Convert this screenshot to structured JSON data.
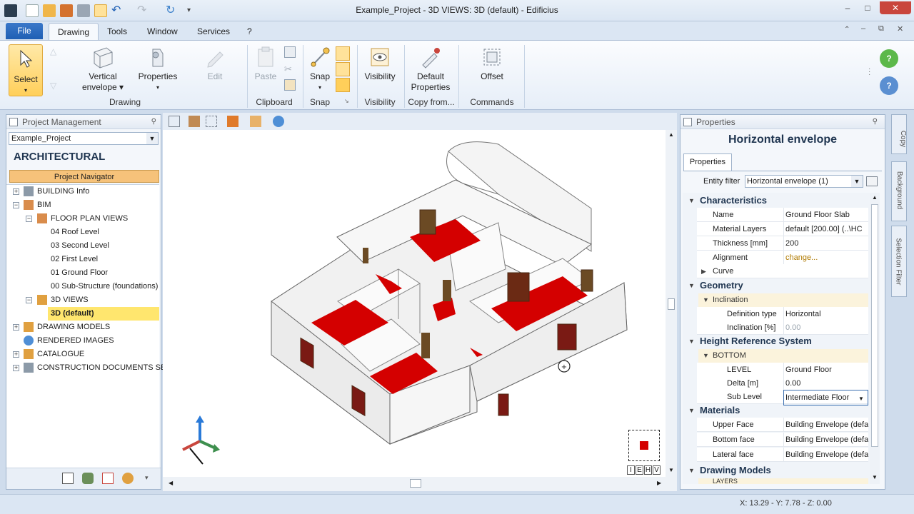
{
  "window": {
    "title": "Example_Project - 3D VIEWS: 3D (default) - Edificius",
    "controls": [
      "–",
      "□",
      "✕"
    ]
  },
  "tabs": {
    "file": "File",
    "items": [
      "Drawing",
      "Tools",
      "Window",
      "Services",
      "?"
    ]
  },
  "ribbon": {
    "select": "Select",
    "vertical_envelope": [
      "Vertical",
      "envelope ▾"
    ],
    "properties": "Properties",
    "edit": "Edit",
    "paste": "Paste",
    "snap": "Snap",
    "visibility": "Visibility",
    "default_properties": [
      "Default",
      "Properties"
    ],
    "offset": "Offset",
    "groups": {
      "drawing": "Drawing",
      "clipboard": "Clipboard",
      "snap": "Snap",
      "visibility": "Visibility",
      "copy_from": "Copy from...",
      "commands": "Commands"
    }
  },
  "project_panel": {
    "title": "Project Management",
    "project_value": "Example_Project",
    "section": "ARCHITECTURAL",
    "navigator": "Project Navigator",
    "tree": [
      {
        "label": "BUILDING Info",
        "level": 0,
        "expander": "+"
      },
      {
        "label": "BIM",
        "level": 0,
        "expander": "−"
      },
      {
        "label": "FLOOR PLAN VIEWS",
        "level": 1,
        "expander": "−"
      },
      {
        "label": "04 Roof Level",
        "level": 2
      },
      {
        "label": "03 Second Level",
        "level": 2
      },
      {
        "label": "02 First Level",
        "level": 2
      },
      {
        "label": "01 Ground Floor",
        "level": 2
      },
      {
        "label": "00 Sub-Structure (foundations)",
        "level": 2
      },
      {
        "label": "3D VIEWS",
        "level": 1,
        "expander": "−"
      },
      {
        "label": "3D (default)",
        "level": 2,
        "selected": true
      },
      {
        "label": "DRAWING MODELS",
        "level": 0,
        "expander": "+"
      },
      {
        "label": "RENDERED IMAGES",
        "level": 0
      },
      {
        "label": "CATALOGUE",
        "level": 0,
        "expander": "+"
      },
      {
        "label": "CONSTRUCTION DOCUMENTS SET",
        "level": 0,
        "expander": "+"
      }
    ]
  },
  "properties_panel": {
    "title": "Properties",
    "heading": "Horizontal envelope",
    "tab": "Properties",
    "entity_filter_label": "Entity filter",
    "entity_filter_value": "Horizontal envelope (1)",
    "categories": {
      "characteristics": "Characteristics",
      "geometry": "Geometry",
      "height_reference": "Height Reference System",
      "materials": "Materials",
      "drawing_models": "Drawing Models"
    },
    "subcategories": {
      "inclination": "Inclination",
      "bottom": "BOTTOM",
      "layers": "LAYERS"
    },
    "rows": {
      "name": [
        "Name",
        "Ground Floor Slab"
      ],
      "material_layers": [
        "Material Layers",
        "default [200.00]  (..\\HC"
      ],
      "thickness": [
        "Thickness  [mm]",
        "200"
      ],
      "alignment": [
        "Alignment",
        "change..."
      ],
      "curve": [
        "Curve",
        ""
      ],
      "definition_type": [
        "Definition type",
        "Horizontal"
      ],
      "inclination_pct": [
        "Inclination  [%]",
        "0.00"
      ],
      "level": [
        "LEVEL",
        "Ground Floor"
      ],
      "delta": [
        "Delta  [m]",
        "0.00"
      ],
      "sub_level": [
        "Sub Level",
        "Intermediate Floor"
      ],
      "upper_face": [
        "Upper Face",
        "Building Envelope (defau"
      ],
      "bottom_face": [
        "Bottom face",
        "Building Envelope (defau"
      ],
      "lateral_face": [
        "Lateral face",
        "Building Envelope (defau"
      ]
    }
  },
  "side_tabs": [
    "Copy",
    "Background",
    "Selection Filter"
  ],
  "view_controls": [
    "I",
    "E",
    "H",
    "V"
  ],
  "status": {
    "coordinates": "X: 13.29 - Y: 7.78 - Z: 0.00"
  },
  "colors": {
    "accent": "#1f5fb4",
    "selection": "#ffe66e",
    "navigator": "#f6c27a",
    "floor_red": "#d40000"
  }
}
